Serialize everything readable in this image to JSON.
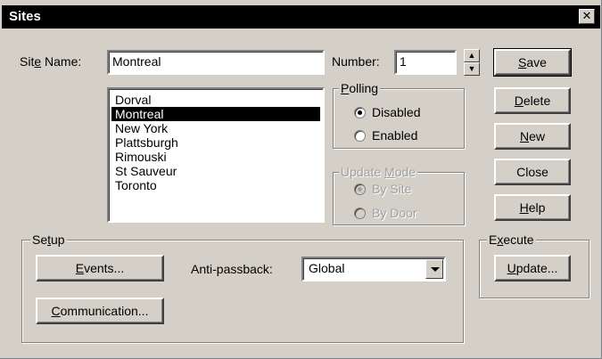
{
  "window": {
    "title": "Sites",
    "close_glyph": "✕"
  },
  "site": {
    "name_label_pre": "Sit",
    "name_label_mn": "e",
    "name_label_post": " Name:",
    "name_value": "Montreal",
    "number_label": "Number:",
    "number_value": "1",
    "spin_up": "▲",
    "spin_down": "▼",
    "list": [
      "Dorval",
      "Montreal",
      "New York",
      "Plattsburgh",
      "Rimouski",
      "St Sauveur",
      "Toronto"
    ],
    "selected": "Montreal"
  },
  "polling": {
    "label_mn": "P",
    "label_rest": "olling",
    "options": [
      {
        "label": "Disabled",
        "checked": true
      },
      {
        "label": "Enabled",
        "checked": false
      }
    ]
  },
  "update_mode": {
    "label_pre": "Update ",
    "label_mn": "M",
    "label_post": "ode",
    "options": [
      {
        "label": "By Site",
        "checked": true,
        "disabled": true
      },
      {
        "label": "By Door",
        "checked": false,
        "disabled": true
      }
    ]
  },
  "buttons": {
    "save_mn": "S",
    "save_rest": "ave",
    "delete_mn": "D",
    "delete_rest": "elete",
    "new_mn": "N",
    "new_rest": "ew",
    "close": "Close",
    "help_mn": "H",
    "help_rest": "elp"
  },
  "setup": {
    "label_pre": "Se",
    "label_mn": "t",
    "label_post": "up",
    "events_mn": "E",
    "events_rest": "vents...",
    "communication_mn": "C",
    "communication_rest": "ommunication...",
    "antipassback_label": "Anti-passback:",
    "antipassback_value": "Global"
  },
  "execute": {
    "label_pre": "E",
    "label_mn": "x",
    "label_post": "ecute",
    "update_mn": "U",
    "update_rest": "pdate..."
  }
}
